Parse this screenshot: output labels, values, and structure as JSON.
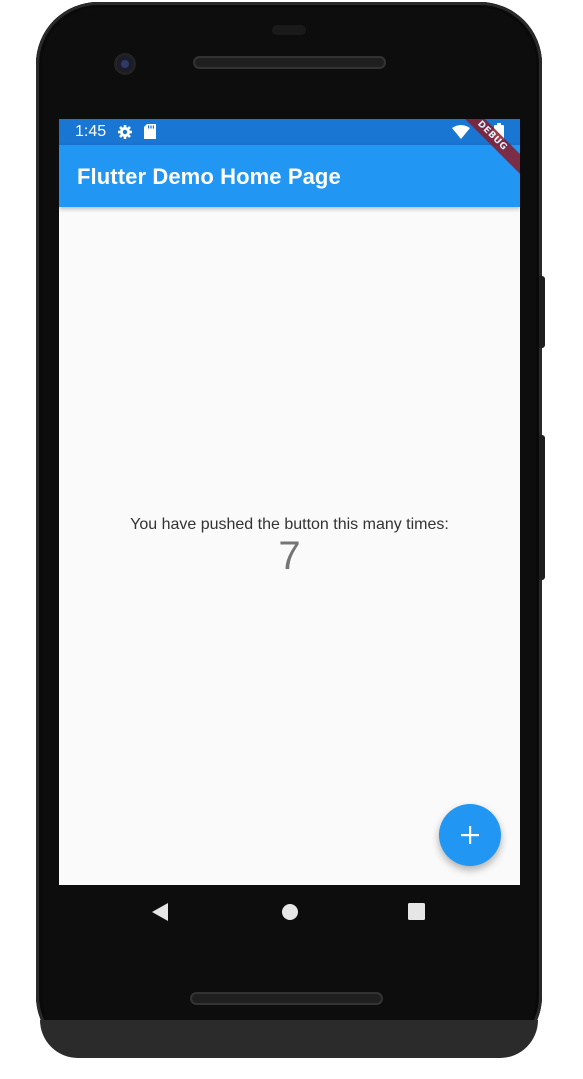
{
  "status_bar": {
    "time": "1:45",
    "icons": [
      "settings-icon",
      "sd-card-icon",
      "wifi-icon",
      "battery-icon"
    ]
  },
  "app_bar": {
    "title": "Flutter Demo Home Page",
    "debug_banner": "DEBUG"
  },
  "main": {
    "message": "You have pushed the button this many times:",
    "counter": "7"
  },
  "fab": {
    "icon": "add-icon"
  },
  "nav_bar": {
    "buttons": [
      "back-icon",
      "home-icon",
      "recents-icon"
    ]
  },
  "colors": {
    "primary": "#2196f3",
    "primary_dark": "#1976d2",
    "background": "#fafafa",
    "debug_banner": "#8b1a2a"
  }
}
